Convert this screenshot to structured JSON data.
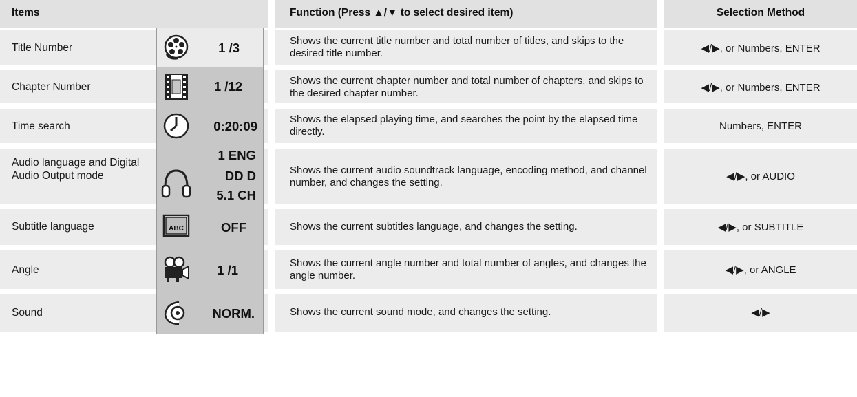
{
  "header": {
    "items": "Items",
    "function": "Function (Press ▲/▼ to select desired item)",
    "method": "Selection Method"
  },
  "rows": [
    {
      "item": "Title Number",
      "icon": "film-reel-icon",
      "osd": "1 /3",
      "function": "Shows the current title number and total number of titles, and skips to the desired title number.",
      "method": "◀/▶, or Numbers, ENTER"
    },
    {
      "item": "Chapter Number",
      "icon": "film-strip-icon",
      "osd": "1 /12",
      "function": "Shows the current chapter number and total number of chapters, and skips to the desired chapter number.",
      "method": "◀/▶, or Numbers, ENTER"
    },
    {
      "item": "Time search",
      "icon": "clock-icon",
      "osd": "0:20:09",
      "function": "Shows the elapsed playing time, and searches the point by the elapsed time directly.",
      "method": "Numbers, ENTER"
    },
    {
      "item": "Audio language and Digital Audio Output mode",
      "icon": "headphones-icon",
      "osd_lines": [
        "1 ENG",
        "DD D",
        "5.1 CH"
      ],
      "function": "Shows the current audio soundtrack language, encoding method, and channel number, and changes the setting.",
      "method": "◀/▶, or AUDIO"
    },
    {
      "item": "Subtitle language",
      "icon": "subtitle-abc-icon",
      "osd": "OFF",
      "icon_text": "ABC",
      "function": "Shows the current subtitles language, and changes the setting.",
      "method": "◀/▶, or SUBTITLE"
    },
    {
      "item": "Angle",
      "icon": "camera-icon",
      "osd": "1 /1",
      "function": "Shows the current angle number and total number of angles, and changes the angle number.",
      "method": "◀/▶, or ANGLE"
    },
    {
      "item": "Sound",
      "icon": "speaker-icon",
      "osd": "NORM.",
      "function": "Shows the current sound mode, and changes the setting.",
      "method": "◀/▶"
    }
  ]
}
